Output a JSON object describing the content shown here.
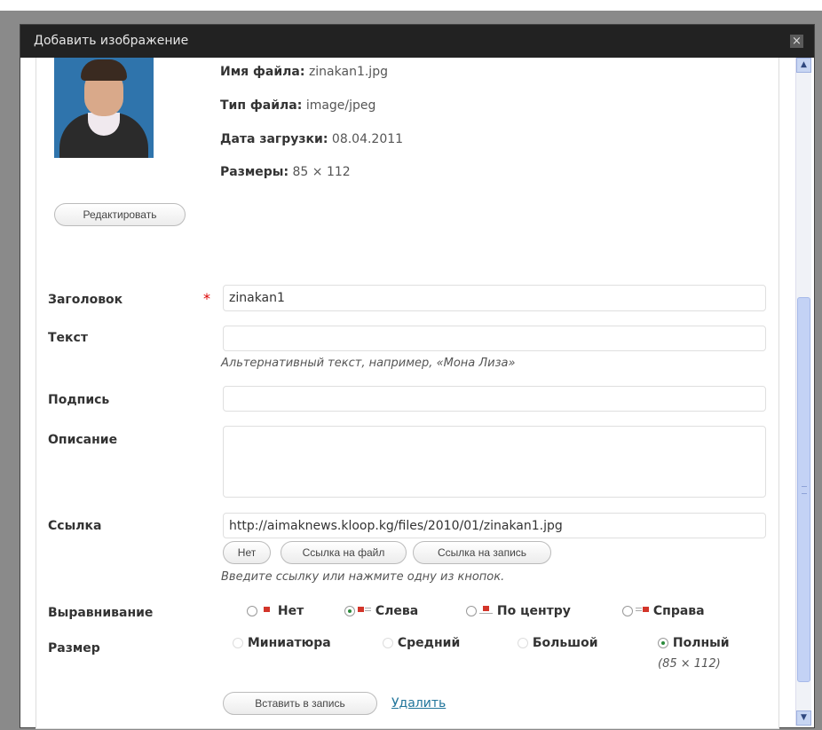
{
  "dialog": {
    "title": "Добавить изображение",
    "close_label": "×"
  },
  "file": {
    "name_label": "Имя файла:",
    "name_value": "zinakan1.jpg",
    "type_label": "Тип файла:",
    "type_value": "image/jpeg",
    "date_label": "Дата загрузки:",
    "date_value": "08.04.2011",
    "size_label": "Размеры:",
    "size_value": "85 × 112",
    "edit_button": "Редактировать"
  },
  "form": {
    "title_label": "Заголовок",
    "required_mark": "*",
    "title_value": "zinakan1",
    "alt_label": "Текст",
    "alt_value": "",
    "alt_hint": "Альтернативный текст, например, «Мона Лиза»",
    "caption_label": "Подпись",
    "caption_value": "",
    "description_label": "Описание",
    "description_value": "",
    "link_label": "Ссылка",
    "link_value": "http://aimaknews.kloop.kg/files/2010/01/zinakan1.jpg",
    "link_buttons": [
      "Нет",
      "Ссылка на файл",
      "Ссылка на запись"
    ],
    "link_hint": "Введите ссылку или нажмите одну из кнопок.",
    "align_label": "Выравнивание",
    "align_options": [
      "Нет",
      "Слева",
      "По центру",
      "Справа"
    ],
    "align_selected": "Слева",
    "size_label": "Размер",
    "size_options": [
      "Миниатюра",
      "Средний",
      "Большой",
      "Полный"
    ],
    "size_selected": "Полный",
    "full_size_note": "(85 × 112)",
    "insert_button": "Вставить в запись",
    "delete_link": "Удалить"
  },
  "colors": {
    "titlebar": "#222222",
    "link": "#21759b",
    "required": "#dd0000",
    "radio_checked": "#2a8a3a",
    "align_icon": "#d3352a"
  },
  "scrollbar": {
    "up_icon": "chevron-up-icon",
    "down_icon": "chevron-down-icon"
  }
}
